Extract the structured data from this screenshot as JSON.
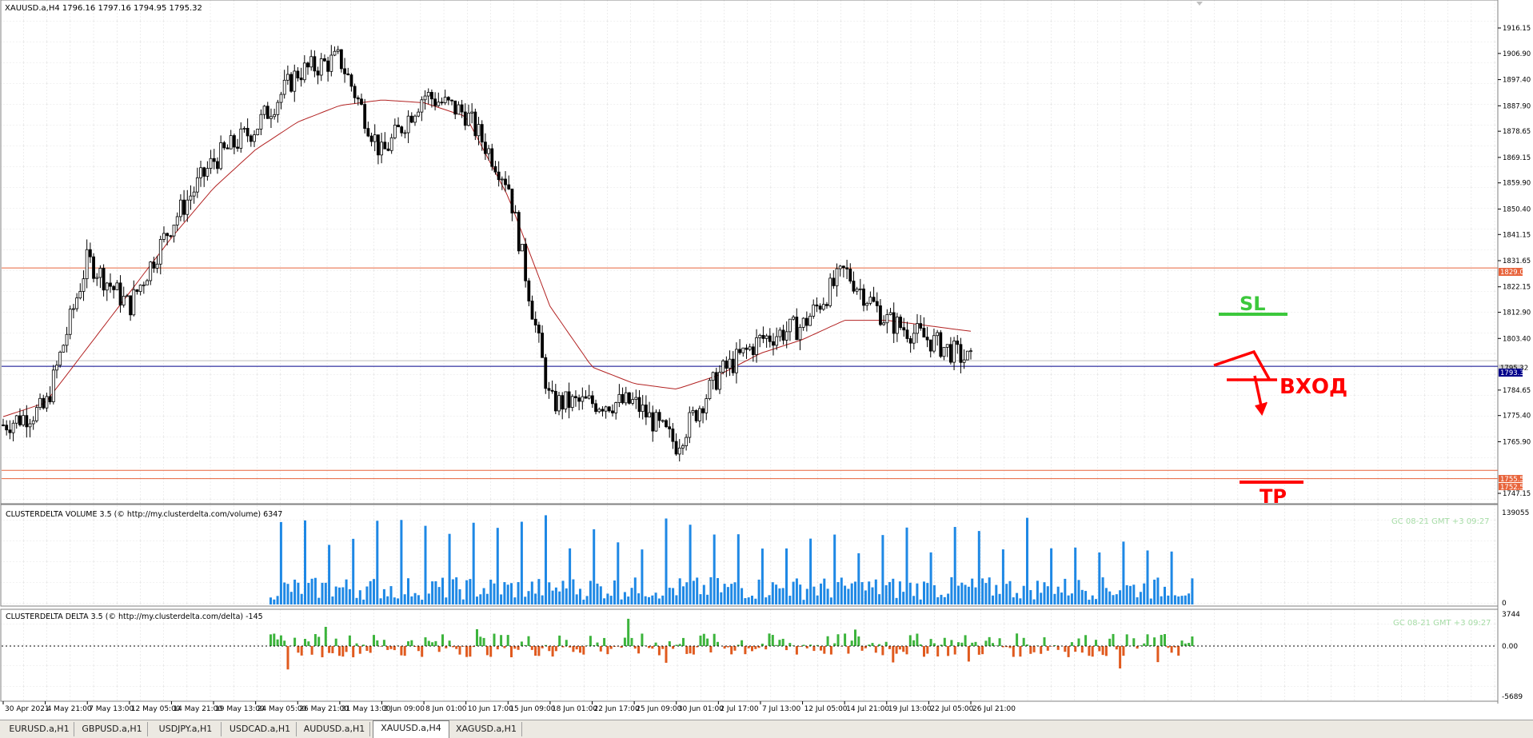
{
  "main_chart": {
    "header": "XAUUSD.a,H4  1796.16 1797.16 1794.95 1795.32",
    "y_ticks": [
      "1916.15",
      "1906.90",
      "1897.40",
      "1887.90",
      "1878.65",
      "1869.15",
      "1859.90",
      "1850.40",
      "1841.15",
      "1831.65",
      "1822.15",
      "1812.90",
      "1803.40",
      "1784.65",
      "1775.40",
      "1765.90",
      "1747.15"
    ],
    "price_tags": {
      "resistance": "1829.00",
      "current": "1795.32",
      "support_line": "1793.30",
      "tp1": "1755.50",
      "tp2": "1752.50"
    },
    "annotations": {
      "sl": "SL",
      "entry": "ВХОД",
      "tp": "TP"
    }
  },
  "volume_panel": {
    "header": "CLUSTERDELTA VOLUME 3.5 (© http://my.clusterdelta.com/volume) 6347",
    "scale_max": "139055",
    "scale_min": "0",
    "timestamp": "GC 08-21 GMT +3  09:27"
  },
  "delta_panel": {
    "header": "CLUSTERDELTA DELTA 3.5 (© http://my.clusterdelta.com/delta) -145",
    "scale_max": "3744",
    "scale_zero": "0.00",
    "scale_min": "-5689",
    "timestamp": "GC 08-21 GMT +3  09:27"
  },
  "x_ticks": [
    "30 Apr 2021",
    "4 May 21:00",
    "7 May 13:00",
    "12 May 05:00",
    "14 May 21:00",
    "19 May 13:00",
    "24 May 05:00",
    "26 May 21:00",
    "31 May 13:00",
    "3 Jun 09:00",
    "8 Jun 01:00",
    "10 Jun 17:00",
    "15 Jun 09:00",
    "18 Jun 01:00",
    "22 Jun 17:00",
    "25 Jun 09:00",
    "30 Jun 01:00",
    "2 Jul 17:00",
    "7 Jul 13:00",
    "12 Jul 05:00",
    "14 Jul 21:00",
    "19 Jul 13:00",
    "22 Jul 05:00",
    "26 Jul 21:00"
  ],
  "tabs": [
    "EURUSD.a,H1",
    "GBPUSD.a,H1",
    "USDJPY.a,H1",
    "USDCAD.a,H1",
    "AUDUSD.a,H1",
    "XAUUSD.a,H4",
    "XAGUSD.a,H1"
  ],
  "active_tab": "XAUUSD.a,H4",
  "colors": {
    "candle": "#000000",
    "ma": "#b22222",
    "resistance": "#e8643c",
    "support": "#00008b",
    "volume": "#1e88e5",
    "delta_pos": "#3cb43c",
    "delta_neg": "#e05a1e",
    "sl": "#3cc83c",
    "annot": "#ff0000"
  },
  "chart_data": {
    "type": "candlestick",
    "symbol": "XAUUSD.a",
    "timeframe": "H4",
    "x_range": [
      "30 Apr 2021",
      "26 Jul 21:00"
    ],
    "y_range": [
      1747.15,
      1916.15
    ],
    "close_path_anchors": [
      {
        "x": "30 Apr 2021",
        "y": 1772
      },
      {
        "x": "4 May 21:00",
        "y": 1778
      },
      {
        "x": "7 May 13:00",
        "y": 1832
      },
      {
        "x": "12 May 05:00",
        "y": 1815
      },
      {
        "x": "14 May 21:00",
        "y": 1845
      },
      {
        "x": "19 May 13:00",
        "y": 1868
      },
      {
        "x": "24 May 05:00",
        "y": 1880
      },
      {
        "x": "26 May 21:00",
        "y": 1900
      },
      {
        "x": "31 May 13:00",
        "y": 1905
      },
      {
        "x": "3 Jun 09:00",
        "y": 1870
      },
      {
        "x": "8 Jun 01:00",
        "y": 1892
      },
      {
        "x": "10 Jun 17:00",
        "y": 1885
      },
      {
        "x": "15 Jun 09:00",
        "y": 1860
      },
      {
        "x": "18 Jun 01:00",
        "y": 1780
      },
      {
        "x": "22 Jun 17:00",
        "y": 1780
      },
      {
        "x": "25 Jun 09:00",
        "y": 1780
      },
      {
        "x": "30 Jun 01:00",
        "y": 1765
      },
      {
        "x": "2 Jul 17:00",
        "y": 1790
      },
      {
        "x": "7 Jul 13:00",
        "y": 1803
      },
      {
        "x": "12 Jul 05:00",
        "y": 1808
      },
      {
        "x": "14 Jul 21:00",
        "y": 1828
      },
      {
        "x": "19 Jul 13:00",
        "y": 1810
      },
      {
        "x": "22 Jul 05:00",
        "y": 1803
      },
      {
        "x": "26 Jul 21:00",
        "y": 1795
      }
    ],
    "ma_path_anchors": [
      1775,
      1780,
      1800,
      1820,
      1840,
      1858,
      1872,
      1882,
      1888,
      1890,
      1889,
      1884,
      1855,
      1815,
      1793,
      1787,
      1785,
      1790,
      1798,
      1803,
      1810,
      1810,
      1808,
      1806
    ],
    "horizontal_levels": [
      1829.0,
      1793.3,
      1755.5,
      1752.5
    ]
  }
}
